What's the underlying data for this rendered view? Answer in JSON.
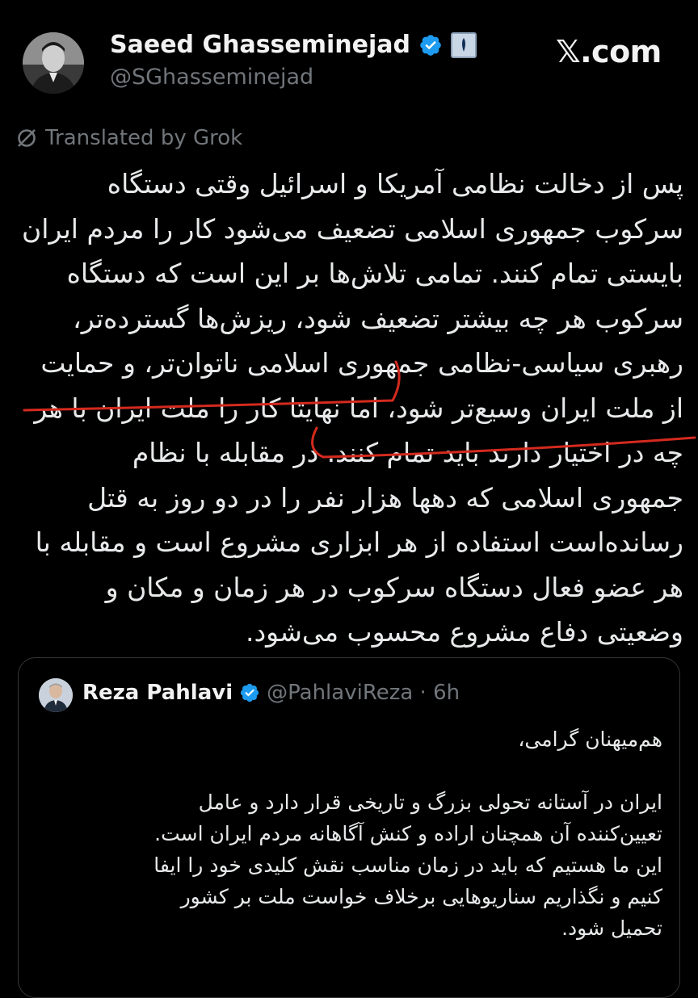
{
  "author": {
    "name": "Saeed Ghasseminejad",
    "handle": "@SGhasseminejad"
  },
  "brand": {
    "label": "𝕏.com"
  },
  "translation_notice": "Translated by Grok",
  "post": {
    "lines": [
      "پس از دخالت نظامی آمریکا و اسرائیل وقتی دستگاه",
      "سرکوب جمهوری اسلامی تضعیف می‌شود کار را مردم ایران",
      "بایستی تمام کنند. تمامی تلاش‌ها بر این است که دستگاه",
      "سرکوب هر چه بیشتر تضعیف شود، ریزش‌ها گسترده‌تر،",
      "رهبری سیاسی-نظامی جمهوری اسلامی ناتوان‌تر، و حمایت",
      "از ملت ایران وسیع‌تر شود، اما نهایتا کار را ملت ایران با هر",
      "چه در اختیار دارند باید تمام کنند. در مقابله با نظام",
      "جمهوری اسلامی که دهها هزار نفر را در دو روز به قتل",
      "رسانده‌است استفاده از هر ابزاری مشروع است و مقابله با",
      "هر عضو فعال دستگاه سرکوب در هر زمان و مکان و",
      "وضعیتی دفاع مشروع محسوب می‌شود."
    ]
  },
  "quoted_post": {
    "name": "Reza Pahlavi",
    "handle_time": "@PahlaviReza · 6h",
    "lines": [
      "هم‌میهنان گرامی،",
      "",
      "ایران در آستانه تحولی بزرگ و تاریخی قرار دارد و عامل",
      "تعیین‌کننده آن همچنان اراده و کنش آگاهانه مردم ایران است.",
      "این ما هستیم که باید در زمان مناسب نقش کلیدی خود را ایفا",
      "کنیم و نگذاریم سناریوهایی برخلاف خواست ملت بر کشور",
      "تحمیل شود."
    ]
  },
  "colors": {
    "background": "#000000",
    "text": "#e7e9ea",
    "muted": "#71767b",
    "verified": "#1d9bf0",
    "annotation": "#d42a1e",
    "card_border": "#333639"
  }
}
